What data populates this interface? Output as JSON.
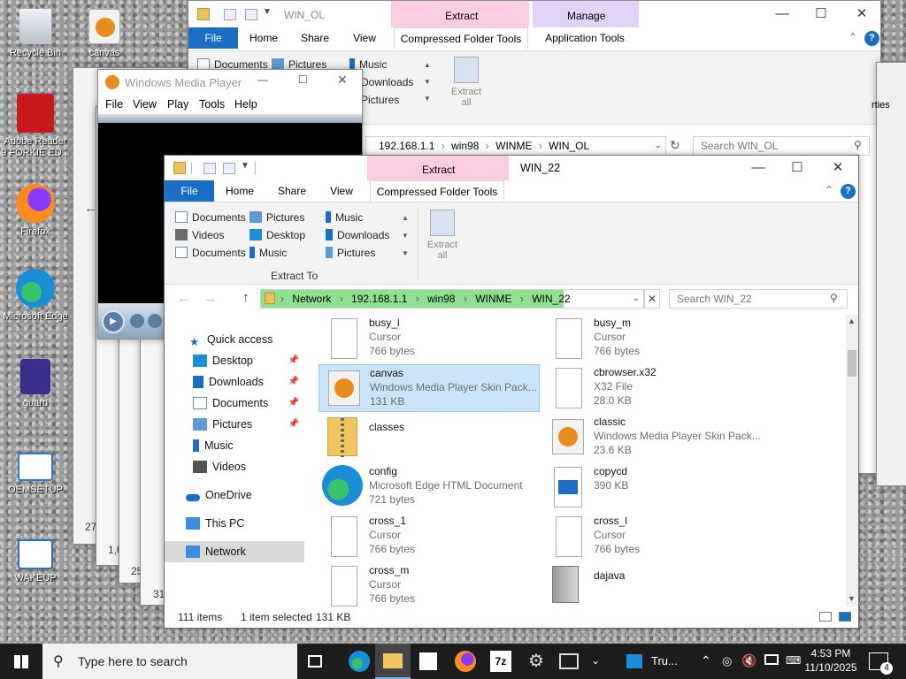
{
  "desktop_icons": [
    {
      "label": "Recycle Bin",
      "color": "#d7dde5"
    },
    {
      "label": "Adobe Reader 9 FORKIE ED...",
      "color": "#c8171d"
    },
    {
      "label": "Firefox",
      "color": "#ff6a1f"
    },
    {
      "label": "Microsoft Edge",
      "color": "#1aa0d8"
    },
    {
      "label": "guard",
      "color": "#3b2f8c"
    },
    {
      "label": "OEMSETUP",
      "color": "#2b7bd3"
    },
    {
      "label": "WAKEUP",
      "color": "#2b6ec9"
    },
    {
      "label": "canvas",
      "color": "#e98b1d"
    }
  ],
  "back_window": {
    "tab_extract": "Extract",
    "tab_manage": "Manage",
    "tabs": [
      "File",
      "Home",
      "Share",
      "View",
      "Compressed Folder Tools",
      "Application Tools"
    ],
    "title": "WIN_OL",
    "ribbon": [
      "Documents",
      "Pictures",
      "Music",
      "Downloads",
      "Pictures"
    ],
    "extract_all": "Extract all",
    "address": [
      "192.168.1.1",
      "win98",
      "WINME",
      "WIN_OL"
    ],
    "search": "Search WIN_OL",
    "right_partial": "rties"
  },
  "wmp": {
    "title": "Windows Media Player",
    "menu": [
      "File",
      "View",
      "Play",
      "Tools",
      "Help"
    ]
  },
  "front_window": {
    "tab_extract": "Extract",
    "title": "WIN_22",
    "tabs": [
      "File",
      "Home",
      "Share",
      "View",
      "Compressed Folder Tools"
    ],
    "ribbon_left": [
      "Documents",
      "Videos",
      "Documents"
    ],
    "ribbon_mid": [
      "Pictures",
      "Desktop",
      "Music"
    ],
    "ribbon_right": [
      "Music",
      "Downloads",
      "Pictures"
    ],
    "extract_to": "Extract To",
    "extract_all": "Extract all",
    "address": [
      "Network",
      "192.168.1.1",
      "win98",
      "WINME",
      "WIN_22"
    ],
    "search": "Search WIN_22",
    "nav": [
      {
        "label": "Quick access",
        "icon": "star-icon",
        "pin": false
      },
      {
        "label": "Desktop",
        "icon": "desktop-icon",
        "pin": true
      },
      {
        "label": "Downloads",
        "icon": "download-icon",
        "pin": true
      },
      {
        "label": "Documents",
        "icon": "documents-icon",
        "pin": true
      },
      {
        "label": "Pictures",
        "icon": "pictures-icon",
        "pin": true
      },
      {
        "label": "Music",
        "icon": "music-icon",
        "pin": false
      },
      {
        "label": "Videos",
        "icon": "videos-icon",
        "pin": false
      },
      {
        "label": "OneDrive",
        "icon": "cloud-icon",
        "pin": false
      },
      {
        "label": "This PC",
        "icon": "pc-icon",
        "pin": false
      },
      {
        "label": "Network",
        "icon": "network-icon",
        "pin": false
      }
    ],
    "files": [
      {
        "name": "busy_l",
        "type": "Cursor",
        "size": "766 bytes",
        "icon": "doc"
      },
      {
        "name": "busy_m",
        "type": "Cursor",
        "size": "766 bytes",
        "icon": "doc"
      },
      {
        "name": "canvas",
        "type": "Windows Media Player Skin Pack...",
        "size": "131 KB",
        "icon": "wmp",
        "selected": true
      },
      {
        "name": "cbrowser.x32",
        "type": "X32 File",
        "size": "28.0 KB",
        "icon": "doc"
      },
      {
        "name": "classes",
        "type": "",
        "size": "",
        "icon": "zip"
      },
      {
        "name": "classic",
        "type": "Windows Media Player Skin Pack...",
        "size": "23.6 KB",
        "icon": "wmp"
      },
      {
        "name": "config",
        "type": "Microsoft Edge HTML Document",
        "size": "721 bytes",
        "icon": "edge"
      },
      {
        "name": "copycd",
        "type": "",
        "size": "390 KB",
        "icon": "clap"
      },
      {
        "name": "cross_1",
        "type": "Cursor",
        "size": "766 bytes",
        "icon": "doc"
      },
      {
        "name": "cross_l",
        "type": "Cursor",
        "size": "766 bytes",
        "icon": "doc"
      },
      {
        "name": "cross_m",
        "type": "Cursor",
        "size": "766 bytes",
        "icon": "doc"
      },
      {
        "name": "dajava",
        "type": "",
        "size": "",
        "icon": "server"
      }
    ],
    "status": {
      "count": "111 items",
      "selected": "1 item selected",
      "size": "131 KB"
    }
  },
  "behind_numbers": [
    "27",
    "1,0",
    "25",
    "31"
  ],
  "taskbar": {
    "search_placeholder": "Type here to search",
    "tru_label": "Tru...",
    "time": "4:53 PM",
    "date": "11/10/2025",
    "notif_count": "4"
  }
}
